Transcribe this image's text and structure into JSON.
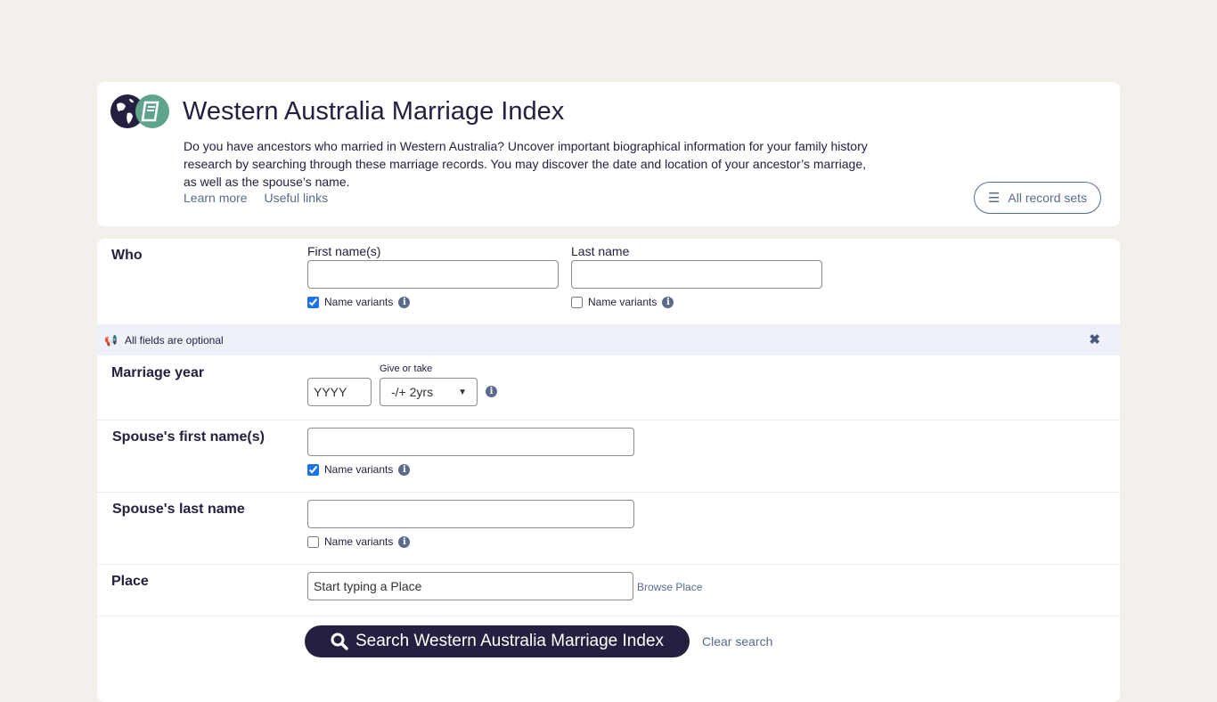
{
  "header": {
    "title": "Western Australia Marriage Index",
    "description": "Do you have ancestors who married in Western Australia? Uncover important biographical information for your family history research by searching through these marriage records. You may discover the date and location of your ancestor’s marriage, as well as the spouse’s name.",
    "learn_more": "Learn more",
    "useful_links": "Useful links",
    "all_record_sets": "All record sets"
  },
  "who": {
    "label": "Who",
    "first_label": "First name(s)",
    "first_value": "",
    "first_variants": true,
    "last_label": "Last name",
    "last_value": "",
    "last_variants": false,
    "variants_label": "Name variants"
  },
  "banner": {
    "text": "All fields are optional"
  },
  "year": {
    "label": "Marriage year",
    "placeholder": "YYYY",
    "give_take_label": "Give or take",
    "give_take_value": "-/+ 2yrs"
  },
  "spouse_first": {
    "label": "Spouse's first name(s)",
    "variants": true,
    "variants_label": "Name variants"
  },
  "spouse_last": {
    "label": "Spouse's last name",
    "variants": false,
    "variants_label": "Name variants"
  },
  "place": {
    "label": "Place",
    "placeholder": "Start typing a Place",
    "browse": "Browse Place"
  },
  "actions": {
    "search": "Search Western Australia Marriage Index",
    "clear": "Clear search"
  },
  "colors": {
    "primary": "#23213f",
    "link": "#5a6b8c",
    "banner_bg": "#eef1f7",
    "page_bg": "#f3f0eb",
    "logo_green": "#5ea48a"
  }
}
